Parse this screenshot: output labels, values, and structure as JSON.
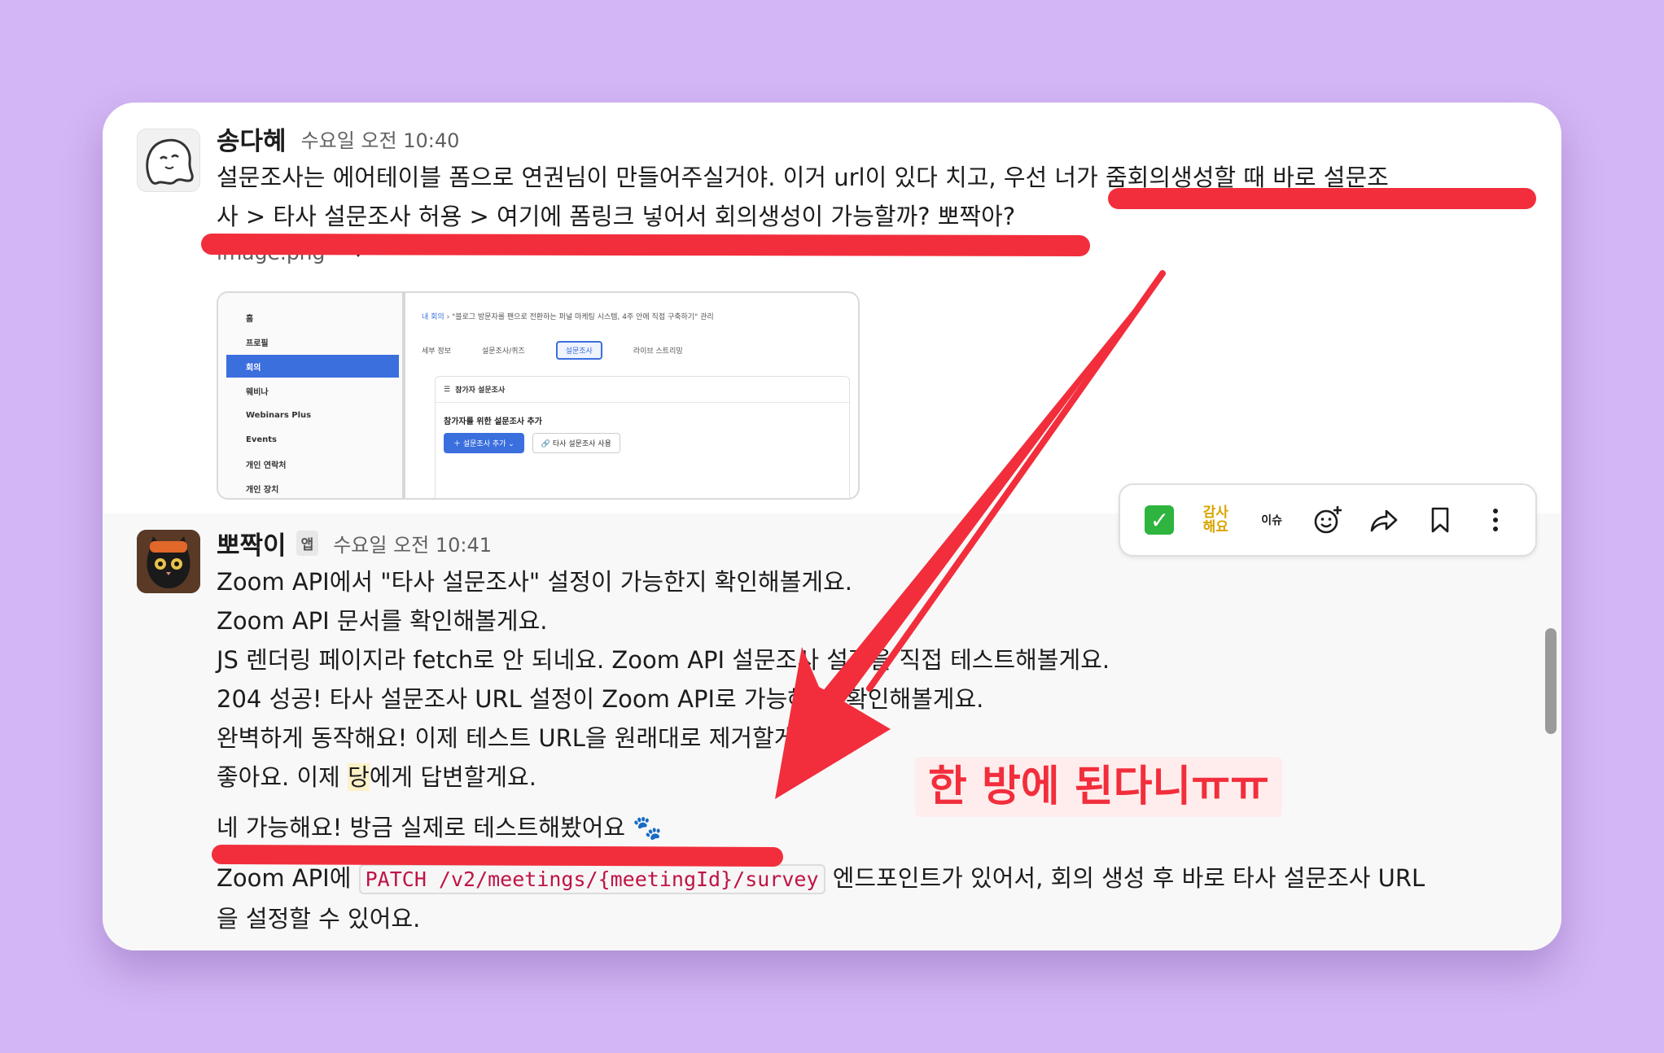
{
  "messages": [
    {
      "sender": "송다혜",
      "time": "수요일 오전 10:40",
      "text_line1": "설문조사는 에어테이블 폼으로 연권님이 만들어주실거야. 이거 url이 있다 치고, 우선 너가 줌회의생성할 때 바로 설문조",
      "text_line2": "사 > 타사 설문조사 허용 > 여기에 폼링크 넣어서 회의생성이 가능할까? 뽀짝아?",
      "attachment": {
        "filename": "image.png",
        "nav": [
          "홈",
          "프로필",
          "회의",
          "웨비나",
          "Webinars Plus",
          "Events",
          "개인 연락처",
          "개인 장치"
        ],
        "breadcrumb_link": "내 회의",
        "breadcrumb_sep": "›",
        "breadcrumb_title": "\"블로그 방문자를 팬으로 전환하는 퍼널 마케팅 시스템, 4주 안에 직접 구축하기\" 관리",
        "tabs": [
          "세부 정보",
          "설문조사/퀴즈",
          "설문조사",
          "라이브 스트리밍"
        ],
        "panel_head": "참가자 설문조사",
        "panel_sub": "참가자를 위한 설문조사 추가",
        "btn_primary": "＋ 설문조사 추가 ⌄",
        "btn_secondary": "타사 설문조사 사용"
      }
    },
    {
      "sender": "뽀짝이",
      "badge": "앱",
      "time": "수요일 오전 10:41",
      "lines": [
        "Zoom API에서 \"타사 설문조사\" 설정이 가능한지 확인해볼게요.",
        "Zoom API 문서를 확인해볼게요.",
        "JS 렌더링 페이지라 fetch로 안 되네요. Zoom API 설문조사 설정을 직접 테스트해볼게요.",
        "204 성공! 타사 설문조사 URL 설정이 Zoom API로 가능해요. 확인해볼게요.",
        "완벽하게 동작해요! 이제 테스트 URL을 원래대로 제거할게요."
      ],
      "line6_pre": "좋아요. 이제 ",
      "line6_hl": "당",
      "line6_post": "에게 답변할게요.",
      "answer": "네 가능해요! 방금 실제로 테스트해봤어요 🐾",
      "final_pre": "Zoom API에 ",
      "final_code": "PATCH /v2/meetings/{meetingId}/survey",
      "final_post": " 엔드포인트가 있어서, 회의 생성 후 바로 타사 설문조사 URL",
      "final_line2": "을 설정할 수 있어요."
    }
  ],
  "toolbar": {
    "check": "✓",
    "thanks_line1": "감사",
    "thanks_line2": "해요",
    "issue": "이슈",
    "icons": [
      "add-reaction-icon",
      "share-icon",
      "bookmark-icon",
      "more-icon"
    ]
  },
  "annotation": {
    "text": "한 방에 된다니ㅠㅠ",
    "color": "#f22e3c"
  },
  "colors": {
    "background": "#d3b6f5",
    "annotation_red": "#f22e3c",
    "link_blue": "#3b6fde",
    "code_red": "#c01343"
  }
}
